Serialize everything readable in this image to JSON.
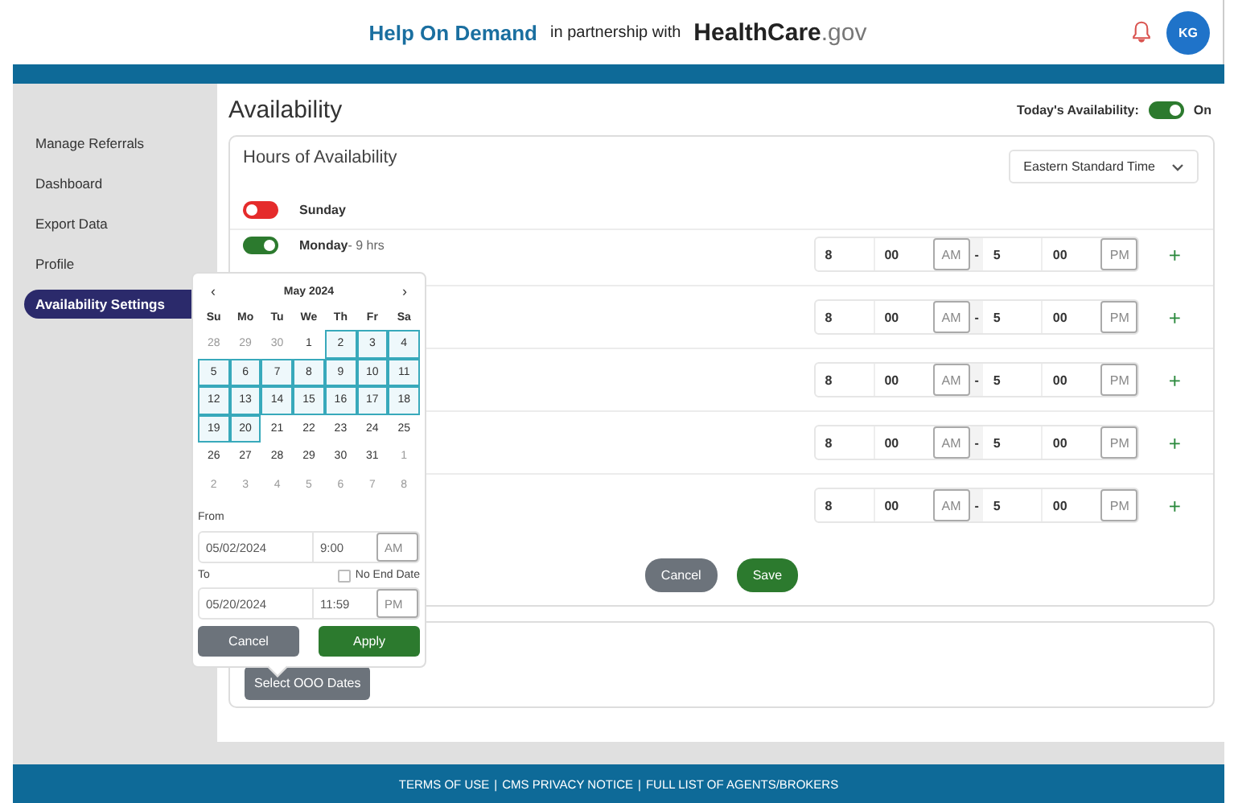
{
  "header": {
    "brand": "Help On Demand",
    "partner": "in partnership with",
    "logo_main": "HealthCare",
    "logo_suffix": ".gov",
    "avatar": "KG"
  },
  "sidebar": {
    "items": [
      {
        "label": "Manage Referrals",
        "selected": false
      },
      {
        "label": "Dashboard",
        "selected": false
      },
      {
        "label": "Export Data",
        "selected": false
      },
      {
        "label": "Profile",
        "selected": false
      },
      {
        "label": "Availability Settings",
        "selected": true
      }
    ]
  },
  "page": {
    "title": "Availability",
    "today": {
      "label": "Today's Availability:",
      "on": true,
      "state": "On"
    }
  },
  "hours": {
    "title": "Hours of Availability",
    "timezone": "Eastern Standard Time",
    "rows": [
      {
        "on": false,
        "day": "Sunday"
      },
      {
        "on": true,
        "day": "Monday",
        "hours": "- 9 hrs",
        "times": {
          "start_h": "8",
          "start_m": "00",
          "start_p": "AM",
          "dash": "-",
          "end_h": "5",
          "end_m": "00",
          "end_p": "PM",
          "add": "+"
        }
      },
      {
        "times": {
          "start_h": "8",
          "start_m": "00",
          "start_p": "AM",
          "dash": "-",
          "end_h": "5",
          "end_m": "00",
          "end_p": "PM",
          "add": "+"
        }
      },
      {
        "times": {
          "start_h": "8",
          "start_m": "00",
          "start_p": "AM",
          "dash": "-",
          "end_h": "5",
          "end_m": "00",
          "end_p": "PM",
          "add": "+"
        }
      },
      {
        "times": {
          "start_h": "8",
          "start_m": "00",
          "start_p": "AM",
          "dash": "-",
          "end_h": "5",
          "end_m": "00",
          "end_p": "PM",
          "add": "+"
        }
      },
      {
        "times": {
          "start_h": "8",
          "start_m": "00",
          "start_p": "AM",
          "dash": "-",
          "end_h": "5",
          "end_m": "00",
          "end_p": "PM",
          "add": "+"
        }
      }
    ],
    "cancel": "Cancel",
    "save": "Save"
  },
  "ooo": {
    "button": "Select OOO Dates"
  },
  "datepicker": {
    "prev": "‹",
    "month": "May 2024",
    "next": "›",
    "weekdays": [
      "Su",
      "Mo",
      "Tu",
      "We",
      "Th",
      "Fr",
      "Sa"
    ],
    "weeks": [
      [
        {
          "d": "28",
          "muted": true,
          "in_range": false
        },
        {
          "d": "29",
          "muted": true,
          "in_range": false
        },
        {
          "d": "30",
          "muted": true,
          "in_range": false
        },
        {
          "d": "1",
          "muted": false,
          "in_range": false
        },
        {
          "d": "2",
          "muted": false,
          "in_range": true
        },
        {
          "d": "3",
          "muted": false,
          "in_range": true
        },
        {
          "d": "4",
          "muted": false,
          "in_range": true
        }
      ],
      [
        {
          "d": "5",
          "muted": false,
          "in_range": true
        },
        {
          "d": "6",
          "muted": false,
          "in_range": true
        },
        {
          "d": "7",
          "muted": false,
          "in_range": true
        },
        {
          "d": "8",
          "muted": false,
          "in_range": true
        },
        {
          "d": "9",
          "muted": false,
          "in_range": true
        },
        {
          "d": "10",
          "muted": false,
          "in_range": true
        },
        {
          "d": "11",
          "muted": false,
          "in_range": true
        }
      ],
      [
        {
          "d": "12",
          "muted": false,
          "in_range": true
        },
        {
          "d": "13",
          "muted": false,
          "in_range": true
        },
        {
          "d": "14",
          "muted": false,
          "in_range": true
        },
        {
          "d": "15",
          "muted": false,
          "in_range": true
        },
        {
          "d": "16",
          "muted": false,
          "in_range": true
        },
        {
          "d": "17",
          "muted": false,
          "in_range": true
        },
        {
          "d": "18",
          "muted": false,
          "in_range": true
        }
      ],
      [
        {
          "d": "19",
          "muted": false,
          "in_range": true
        },
        {
          "d": "20",
          "muted": false,
          "in_range": true
        },
        {
          "d": "21",
          "muted": false,
          "in_range": false
        },
        {
          "d": "22",
          "muted": false,
          "in_range": false
        },
        {
          "d": "23",
          "muted": false,
          "in_range": false
        },
        {
          "d": "24",
          "muted": false,
          "in_range": false
        },
        {
          "d": "25",
          "muted": false,
          "in_range": false
        }
      ],
      [
        {
          "d": "26",
          "muted": false,
          "in_range": false
        },
        {
          "d": "27",
          "muted": false,
          "in_range": false
        },
        {
          "d": "28",
          "muted": false,
          "in_range": false
        },
        {
          "d": "29",
          "muted": false,
          "in_range": false
        },
        {
          "d": "30",
          "muted": false,
          "in_range": false
        },
        {
          "d": "31",
          "muted": false,
          "in_range": false
        },
        {
          "d": "1",
          "muted": true,
          "in_range": false
        }
      ],
      [
        {
          "d": "2",
          "muted": true,
          "in_range": false
        },
        {
          "d": "3",
          "muted": true,
          "in_range": false
        },
        {
          "d": "4",
          "muted": true,
          "in_range": false
        },
        {
          "d": "5",
          "muted": true,
          "in_range": false
        },
        {
          "d": "6",
          "muted": true,
          "in_range": false
        },
        {
          "d": "7",
          "muted": true,
          "in_range": false
        },
        {
          "d": "8",
          "muted": true,
          "in_range": false
        }
      ]
    ],
    "from_label": "From",
    "from": {
      "date": "05/02/2024",
      "time": "9:00",
      "period": "AM"
    },
    "to_label": "To",
    "no_end_date": {
      "label": "No End Date",
      "checked": false
    },
    "to": {
      "date": "05/20/2024",
      "time": "11:59",
      "period": "PM"
    },
    "cancel": "Cancel",
    "apply": "Apply"
  },
  "footer": {
    "links": [
      "TERMS OF USE",
      "CMS PRIVACY NOTICE",
      "FULL LIST OF AGENTS/BROKERS"
    ],
    "separator": "|"
  }
}
